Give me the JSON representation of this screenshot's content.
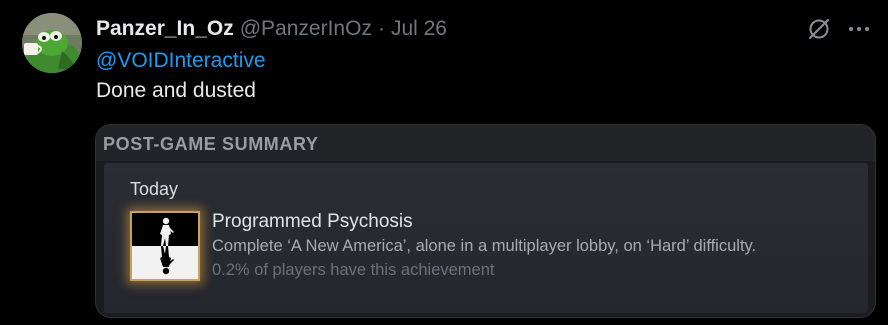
{
  "tweet": {
    "display_name": "Panzer_In_Oz",
    "handle": "@PanzerInOz",
    "separator": "·",
    "date": "Jul 26",
    "mention": "@VOIDInteractive",
    "text": "Done and dusted"
  },
  "icons": {
    "avatar": "kermit-sipping-tea-avatar",
    "grok": "grok-icon",
    "more": "more-icon",
    "achievement": "achievement-silhouette-icon"
  },
  "media": {
    "header": "POST-GAME SUMMARY",
    "day_label": "Today",
    "achievement": {
      "name": "Programmed Psychosis",
      "description": "Complete ‘A New America’, alone in a multiplayer lobby, on ‘Hard’ difficulty.",
      "rarity": "0.2% of players have this achievement"
    }
  },
  "colors": {
    "background": "#000000",
    "link": "#1d9bf0",
    "muted": "#71767b",
    "glow": "#e6aa46"
  }
}
